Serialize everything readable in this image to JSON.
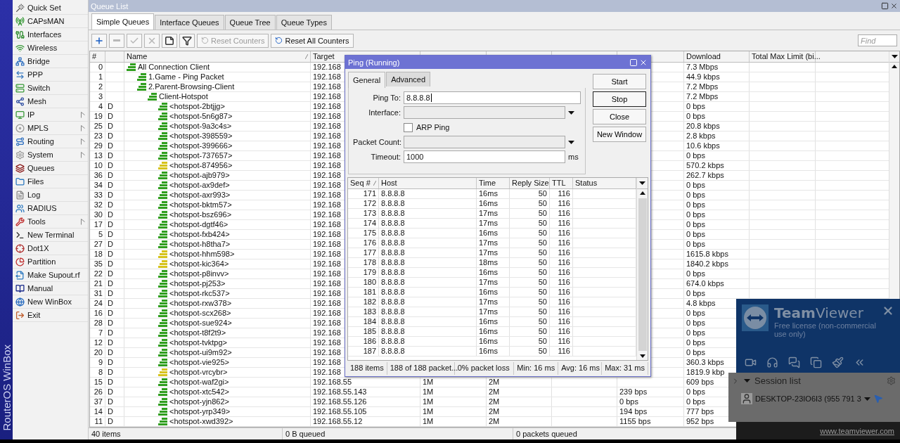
{
  "sidebar": {
    "brand": "RouterOS WinBox",
    "items": [
      {
        "label": "Quick Set",
        "submenu": false
      },
      {
        "label": "CAPsMAN",
        "submenu": false
      },
      {
        "label": "Interfaces",
        "submenu": false
      },
      {
        "label": "Wireless",
        "submenu": false
      },
      {
        "label": "Bridge",
        "submenu": false
      },
      {
        "label": "PPP",
        "submenu": false
      },
      {
        "label": "Switch",
        "submenu": false
      },
      {
        "label": "Mesh",
        "submenu": false
      },
      {
        "label": "IP",
        "submenu": true
      },
      {
        "label": "MPLS",
        "submenu": true
      },
      {
        "label": "Routing",
        "submenu": true
      },
      {
        "label": "System",
        "submenu": true
      },
      {
        "label": "Queues",
        "submenu": false
      },
      {
        "label": "Files",
        "submenu": false
      },
      {
        "label": "Log",
        "submenu": false
      },
      {
        "label": "RADIUS",
        "submenu": false
      },
      {
        "label": "Tools",
        "submenu": true
      },
      {
        "label": "New Terminal",
        "submenu": false
      },
      {
        "label": "Dot1X",
        "submenu": false
      },
      {
        "label": "Partition",
        "submenu": false
      },
      {
        "label": "Make Supout.rf",
        "submenu": false
      },
      {
        "label": "Manual",
        "submenu": false
      },
      {
        "label": "New WinBox",
        "submenu": false
      },
      {
        "label": "Exit",
        "submenu": false
      }
    ]
  },
  "window": {
    "title": "Queue List"
  },
  "tabs": [
    {
      "label": "Simple Queues",
      "selected": true
    },
    {
      "label": "Interface Queues",
      "selected": false
    },
    {
      "label": "Queue Tree",
      "selected": false
    },
    {
      "label": "Queue Types",
      "selected": false
    }
  ],
  "toolbar": {
    "icon_buttons": [
      {
        "kind": "add",
        "disabled": false
      },
      {
        "kind": "remove",
        "disabled": true
      },
      {
        "kind": "enable",
        "disabled": true
      },
      {
        "kind": "disable",
        "disabled": true
      },
      {
        "kind": "comment",
        "disabled": false
      },
      {
        "kind": "filter",
        "disabled": false
      }
    ],
    "text_buttons": [
      {
        "label": "Reset Counters",
        "disabled": true
      },
      {
        "label": "Reset All Counters",
        "disabled": false
      }
    ],
    "search": {
      "placeholder": "Find"
    }
  },
  "table": {
    "header": {
      "number": "#",
      "name": "Name",
      "target": "Target",
      "download": "Download",
      "total_max_limit": "Total Max Limit (bi..."
    },
    "rows": [
      {
        "number": "0",
        "name": "All Connection Client",
        "color": "#2f9e1e",
        "target": "192.168",
        "download": "7.3 Mbps",
        "children": [
          {
            "number": "1",
            "name": "1.Game - Ping Packet",
            "color": "#2f9e1e",
            "target": "192.168",
            "download": "44.9 kbps"
          },
          {
            "number": "2",
            "name": "2.Parent-Browsing-Client",
            "color": "#2f9e1e",
            "target": "192.168",
            "download": "7.2 Mbps",
            "children": [
              {
                "number": "3",
                "name": "Client-Hotspot",
                "color": "#2f9e1e",
                "target": "192.168",
                "download": "7.2 Mbps",
                "children": [
                  {
                    "number": "4",
                    "flag": "D",
                    "name": "<hotspot-2btjjg>",
                    "color": "#2f9e1e",
                    "target": "192.168",
                    "download": "0 bps"
                  },
                  {
                    "number": "19",
                    "flag": "D",
                    "name": "<hotspot-5n6g87>",
                    "color": "#2f9e1e",
                    "target": "192.168",
                    "download": "0 bps"
                  },
                  {
                    "number": "25",
                    "flag": "D",
                    "name": "<hotspot-9a3c4s>",
                    "color": "#2f9e1e",
                    "target": "192.168",
                    "download": "20.8 kbps"
                  },
                  {
                    "number": "23",
                    "flag": "D",
                    "name": "<hotspot-398559>",
                    "color": "#2f9e1e",
                    "target": "192.168",
                    "download": "2.8 kbps"
                  },
                  {
                    "number": "29",
                    "flag": "D",
                    "name": "<hotspot-399666>",
                    "color": "#2f9e1e",
                    "target": "192.168",
                    "download": "10.6 kbps"
                  },
                  {
                    "number": "13",
                    "flag": "D",
                    "name": "<hotspot-737657>",
                    "color": "#2f9e1e",
                    "target": "192.168",
                    "download": "0 bps"
                  },
                  {
                    "number": "10",
                    "flag": "D",
                    "name": "<hotspot-874956>",
                    "color": "#d6c31c",
                    "target": "192.168",
                    "download": "570.2 kbps"
                  },
                  {
                    "number": "36",
                    "flag": "D",
                    "name": "<hotspot-ajb979>",
                    "color": "#2f9e1e",
                    "target": "192.168",
                    "download": "262.7 kbps"
                  },
                  {
                    "number": "34",
                    "flag": "D",
                    "name": "<hotspot-ax9def>",
                    "color": "#2f9e1e",
                    "target": "192.168",
                    "download": "0 bps"
                  },
                  {
                    "number": "33",
                    "flag": "D",
                    "name": "<hotspot-axr993>",
                    "color": "#2f9e1e",
                    "target": "192.168",
                    "download": "0 bps"
                  },
                  {
                    "number": "32",
                    "flag": "D",
                    "name": "<hotspot-bktm57>",
                    "color": "#2f9e1e",
                    "target": "192.168",
                    "download": "0 bps"
                  },
                  {
                    "number": "30",
                    "flag": "D",
                    "name": "<hotspot-bsz696>",
                    "color": "#2f9e1e",
                    "target": "192.168",
                    "download": "0 bps"
                  },
                  {
                    "number": "17",
                    "flag": "D",
                    "name": "<hotspot-dgtf46>",
                    "color": "#2f9e1e",
                    "target": "192.168",
                    "download": "0 bps"
                  },
                  {
                    "number": "5",
                    "flag": "D",
                    "name": "<hotspot-fxb424>",
                    "color": "#2f9e1e",
                    "target": "192.168",
                    "download": "0 bps"
                  },
                  {
                    "number": "27",
                    "flag": "D",
                    "name": "<hotspot-h8tha7>",
                    "color": "#2f9e1e",
                    "target": "192.168",
                    "download": "0 bps"
                  },
                  {
                    "number": "18",
                    "flag": "D",
                    "name": "<hotspot-hhm598>",
                    "color": "#d6c31c",
                    "target": "192.168",
                    "download": "1615.8 kbps"
                  },
                  {
                    "number": "35",
                    "flag": "D",
                    "name": "<hotspot-kic364>",
                    "color": "#d6c31c",
                    "target": "192.168",
                    "download": "1840.2 kbps"
                  },
                  {
                    "number": "22",
                    "flag": "D",
                    "name": "<hotspot-p8invv>",
                    "color": "#2f9e1e",
                    "target": "192.168",
                    "download": "0 bps"
                  },
                  {
                    "number": "21",
                    "flag": "D",
                    "name": "<hotspot-pj253>",
                    "color": "#2f9e1e",
                    "target": "192.168",
                    "download": "674.0 kbps"
                  },
                  {
                    "number": "31",
                    "flag": "D",
                    "name": "<hotspot-rkc537>",
                    "color": "#2f9e1e",
                    "target": "192.168",
                    "download": "0 bps"
                  },
                  {
                    "number": "24",
                    "flag": "D",
                    "name": "<hotspot-rxw378>",
                    "color": "#2f9e1e",
                    "target": "192.168",
                    "download": "4.8 kbps"
                  },
                  {
                    "number": "16",
                    "flag": "D",
                    "name": "<hotspot-scx268>",
                    "color": "#2f9e1e",
                    "target": "192.168",
                    "download": "0 bps"
                  },
                  {
                    "number": "28",
                    "flag": "D",
                    "name": "<hotspot-sue924>",
                    "color": "#2f9e1e",
                    "target": "192.168",
                    "download": "0 bps"
                  },
                  {
                    "number": "7",
                    "flag": "D",
                    "name": "<hotspot-t8f2t9>",
                    "color": "#2f9e1e",
                    "target": "192.168",
                    "download": "0 bps"
                  },
                  {
                    "number": "12",
                    "flag": "D",
                    "name": "<hotspot-tvktpg>",
                    "color": "#2f9e1e",
                    "target": "192.168",
                    "download": "0 bps"
                  },
                  {
                    "number": "20",
                    "flag": "D",
                    "name": "<hotspot-ui9m92>",
                    "color": "#2f9e1e",
                    "target": "192.168",
                    "download": "0 bps"
                  },
                  {
                    "number": "9",
                    "flag": "D",
                    "name": "<hotspot-vie925>",
                    "color": "#2f9e1e",
                    "target": "192.168",
                    "download": "360.3 kbps"
                  },
                  {
                    "number": "8",
                    "flag": "D",
                    "name": "<hotspot-vrcybr>",
                    "color": "#d6c31c",
                    "target": "192.168",
                    "download": "1819.9 kbp"
                  },
                  {
                    "number": "15",
                    "flag": "D",
                    "name": "<hotspot-waf2gi>",
                    "color": "#2f9e1e",
                    "target": "192.168.55",
                    "upload_max_limit": "1M",
                    "download_max_limit": "2M",
                    "download": "609 bps"
                  },
                  {
                    "number": "26",
                    "flag": "D",
                    "name": "<hotspot-xtc542>",
                    "color": "#2f9e1e",
                    "target": "192.168.55.143",
                    "upload_max_limit": "1M",
                    "download_max_limit": "2M",
                    "upload": "239 bps",
                    "download": "0 bps"
                  },
                  {
                    "number": "37",
                    "flag": "D",
                    "name": "<hotspot-yjn862>",
                    "color": "#2f9e1e",
                    "target": "192.168.55.126",
                    "upload_max_limit": "1M",
                    "download_max_limit": "2M",
                    "upload": "0 bps",
                    "download": "0 bps"
                  },
                  {
                    "number": "14",
                    "flag": "D",
                    "name": "<hotspot-yrp349>",
                    "color": "#2f9e1e",
                    "target": "192.168.55.105",
                    "upload_max_limit": "1M",
                    "download_max_limit": "2M",
                    "upload": "194 bps",
                    "download": "777 bps"
                  },
                  {
                    "number": "11",
                    "flag": "D",
                    "name": "<hotspot-xwd392>",
                    "color": "#2f9e1e",
                    "target": "192.168.55.12",
                    "upload_max_limit": "1M",
                    "download_max_limit": "2M",
                    "upload": "1155 bps",
                    "download": "952 bps"
                  }
                ]
              }
            ]
          }
        ]
      }
    ]
  },
  "status_bar": [
    "40 items",
    "0 B queued",
    "0 packets queued"
  ],
  "ping": {
    "title": "Ping (Running)",
    "tabs": [
      {
        "label": "General",
        "selected": true
      },
      {
        "label": "Advanced",
        "selected": false
      }
    ],
    "fields": [
      {
        "kind": "text",
        "label": "Ping To:",
        "value": "8.8.8.8"
      },
      {
        "kind": "dropdown",
        "label": "Interface:"
      },
      {
        "kind": "checkbox",
        "label": "ARP Ping",
        "checked": false
      },
      {
        "kind": "dropdown",
        "label": "Packet Count:"
      },
      {
        "kind": "text",
        "label": "Timeout:",
        "value": "1000",
        "unit": "ms"
      }
    ],
    "buttons": [
      {
        "label": "Start",
        "focused": false
      },
      {
        "label": "Stop",
        "focused": true
      },
      {
        "label": "Close",
        "focused": false
      },
      {
        "label": "New Window",
        "focused": false
      }
    ],
    "columns": [
      "Seq #",
      "Host",
      "Time",
      "Reply Size",
      "TTL",
      "Status"
    ],
    "rows": [
      [
        "171",
        "8.8.8.8",
        "16ms",
        "50",
        "116"
      ],
      [
        "172",
        "8.8.8.8",
        "16ms",
        "50",
        "116"
      ],
      [
        "173",
        "8.8.8.8",
        "17ms",
        "50",
        "116"
      ],
      [
        "174",
        "8.8.8.8",
        "17ms",
        "50",
        "116"
      ],
      [
        "175",
        "8.8.8.8",
        "16ms",
        "50",
        "116"
      ],
      [
        "176",
        "8.8.8.8",
        "17ms",
        "50",
        "116"
      ],
      [
        "177",
        "8.8.8.8",
        "17ms",
        "50",
        "116"
      ],
      [
        "178",
        "8.8.8.8",
        "18ms",
        "50",
        "116"
      ],
      [
        "179",
        "8.8.8.8",
        "16ms",
        "50",
        "116"
      ],
      [
        "180",
        "8.8.8.8",
        "17ms",
        "50",
        "116"
      ],
      [
        "181",
        "8.8.8.8",
        "16ms",
        "50",
        "116"
      ],
      [
        "182",
        "8.8.8.8",
        "17ms",
        "50",
        "116"
      ],
      [
        "183",
        "8.8.8.8",
        "17ms",
        "50",
        "116"
      ],
      [
        "184",
        "8.8.8.8",
        "16ms",
        "50",
        "116"
      ],
      [
        "185",
        "8.8.8.8",
        "16ms",
        "50",
        "116"
      ],
      [
        "186",
        "8.8.8.8",
        "16ms",
        "50",
        "116"
      ],
      [
        "187",
        "8.8.8.8",
        "16ms",
        "50",
        "116"
      ]
    ],
    "status": [
      "188 items",
      "188 of 188 packet...",
      "0% packet loss",
      "Min: 16 ms",
      "Avg: 16 ms",
      "Max: 31 ms"
    ]
  },
  "teamviewer": {
    "brand": "**Team**Viewer",
    "license": "Free license (non-commercial use only)",
    "session_list": "Session list",
    "sessions": [
      {
        "name": "DESKTOP-23IO6I3 (955 791 3"
      }
    ],
    "link": "www.teamviewer.com"
  }
}
